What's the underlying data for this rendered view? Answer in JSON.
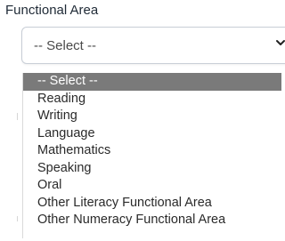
{
  "field": {
    "label": "Functional Area",
    "selected_value": "-- Select --"
  },
  "dropdown": {
    "options": [
      "-- Select --",
      "Reading",
      "Writing",
      "Language",
      "Mathematics",
      "Speaking",
      "Oral",
      "Other Literacy Functional Area",
      "Other Numeracy Functional Area"
    ],
    "highlighted_index": 0
  },
  "colors": {
    "highlight_bg": "#7a7a7a",
    "highlight_text": "#ffffff",
    "text": "#2a2a2a",
    "border": "#c8ced6"
  },
  "icons": {
    "select_caret": "chevron-down-icon"
  }
}
